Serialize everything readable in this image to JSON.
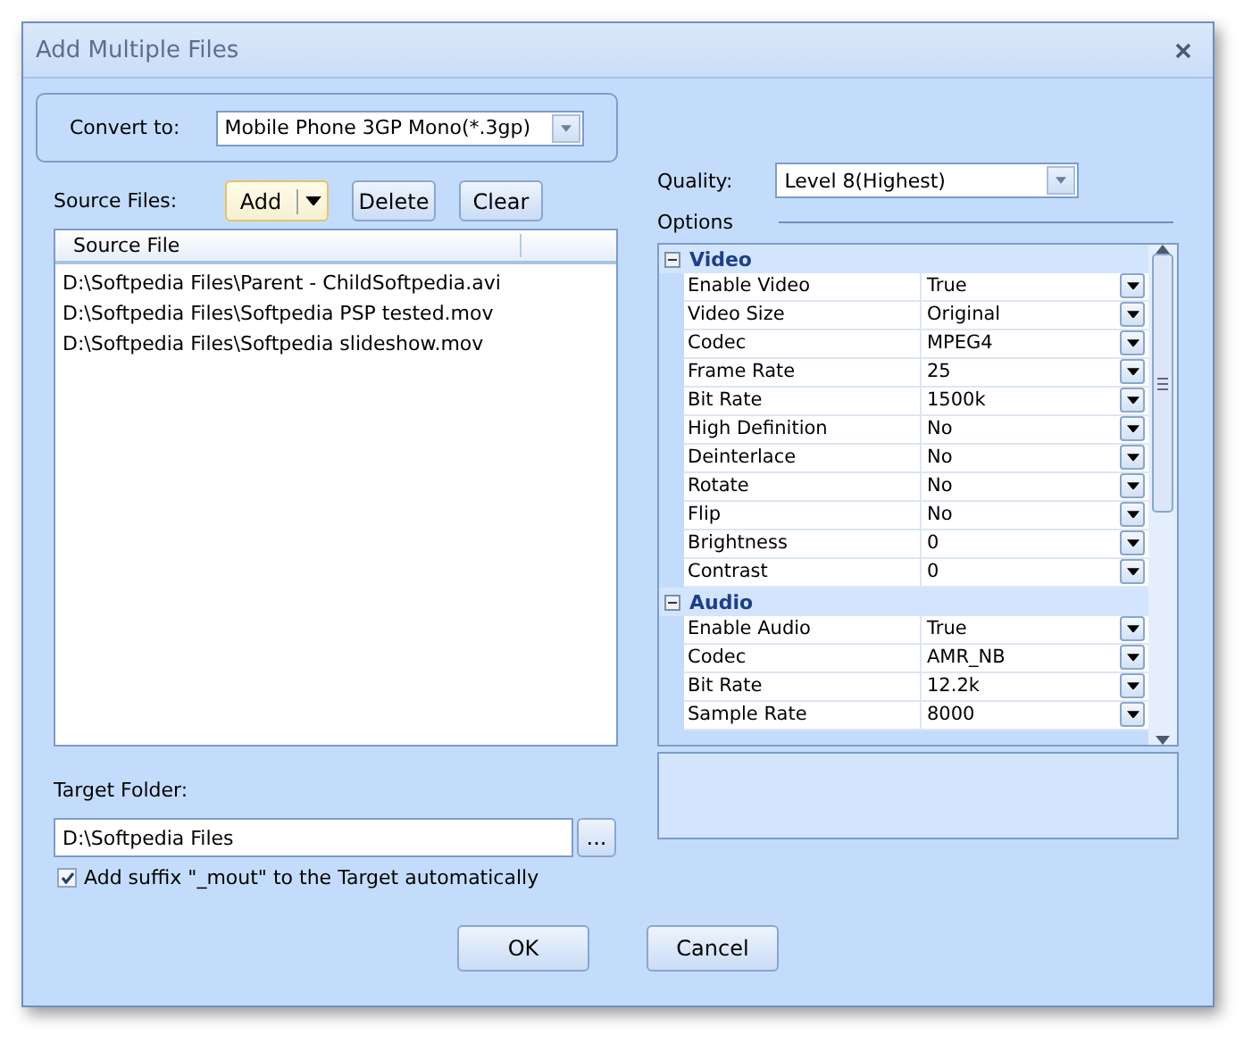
{
  "window": {
    "title": "Add Multiple Files"
  },
  "convert_to": {
    "label": "Convert to:",
    "value": "Mobile Phone 3GP Mono(*.3gp)"
  },
  "source_files": {
    "label": "Source Files:",
    "buttons": [
      "Add",
      "Delete",
      "Clear"
    ],
    "column": "Source File",
    "files": [
      "D:\\Softpedia Files\\Parent - ChildSoftpedia.avi",
      "D:\\Softpedia Files\\Softpedia PSP tested.mov",
      "D:\\Softpedia Files\\Softpedia slideshow.mov"
    ]
  },
  "target_folder": {
    "label": "Target Folder:",
    "value": "D:\\Softpedia Files",
    "browse": "...",
    "suffix_option": {
      "label": "Add suffix \"_mout\" to the Target automatically",
      "checked": true
    }
  },
  "quality": {
    "label": "Quality:",
    "value": "Level 8(Highest)"
  },
  "options": {
    "label": "Options",
    "groups": [
      {
        "name": "Video",
        "expanded": true,
        "properties": [
          {
            "name": "Enable Video",
            "value": "True"
          },
          {
            "name": "Video Size",
            "value": "Original"
          },
          {
            "name": "Codec",
            "value": "MPEG4"
          },
          {
            "name": "Frame Rate",
            "value": "25"
          },
          {
            "name": "Bit Rate",
            "value": "1500k"
          },
          {
            "name": "High Definition",
            "value": "No"
          },
          {
            "name": "Deinterlace",
            "value": "No"
          },
          {
            "name": "Rotate",
            "value": "No"
          },
          {
            "name": "Flip",
            "value": "No"
          },
          {
            "name": "Brightness",
            "value": "0"
          },
          {
            "name": "Contrast",
            "value": "0"
          }
        ]
      },
      {
        "name": "Audio",
        "expanded": true,
        "properties": [
          {
            "name": "Enable Audio",
            "value": "True"
          },
          {
            "name": "Codec",
            "value": "AMR_NB"
          },
          {
            "name": "Bit Rate",
            "value": "12.2k"
          },
          {
            "name": "Sample Rate",
            "value": "8000"
          }
        ]
      }
    ]
  },
  "buttons": [
    "OK",
    "Cancel"
  ]
}
